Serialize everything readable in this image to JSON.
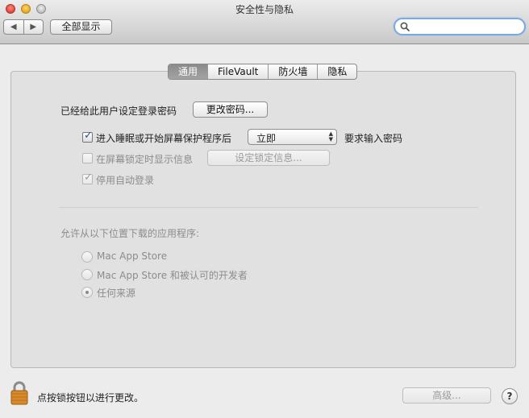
{
  "window": {
    "title": "安全性与隐私"
  },
  "toolbar": {
    "back": "◀",
    "forward": "▶",
    "show_all": "全部显示",
    "search_placeholder": ""
  },
  "tabs": [
    {
      "label": "通用",
      "active": true
    },
    {
      "label": "FileVault",
      "active": false
    },
    {
      "label": "防火墙",
      "active": false
    },
    {
      "label": "隐私",
      "active": false
    }
  ],
  "general": {
    "password_set_text": "已经给此用户设定登录密码",
    "change_password_button": "更改密码...",
    "require_password": {
      "checked": true,
      "label_before": "进入睡眠或开始屏幕保护程序后",
      "select_value": "立即",
      "label_after": "要求输入密码"
    },
    "show_message": {
      "checked": false,
      "label": "在屏幕锁定时显示信息",
      "button": "设定锁定信息..."
    },
    "disable_auto_login": {
      "checked": true,
      "label": "停用自动登录"
    }
  },
  "downloads": {
    "heading": "允许从以下位置下载的应用程序:",
    "options": [
      {
        "label": "Mac App Store",
        "selected": false
      },
      {
        "label": "Mac App Store 和被认可的开发者",
        "selected": false
      },
      {
        "label": "任何来源",
        "selected": true
      }
    ]
  },
  "footer": {
    "lock_text": "点按锁按钮以进行更改。",
    "advanced_button": "高级...",
    "help": "?"
  }
}
